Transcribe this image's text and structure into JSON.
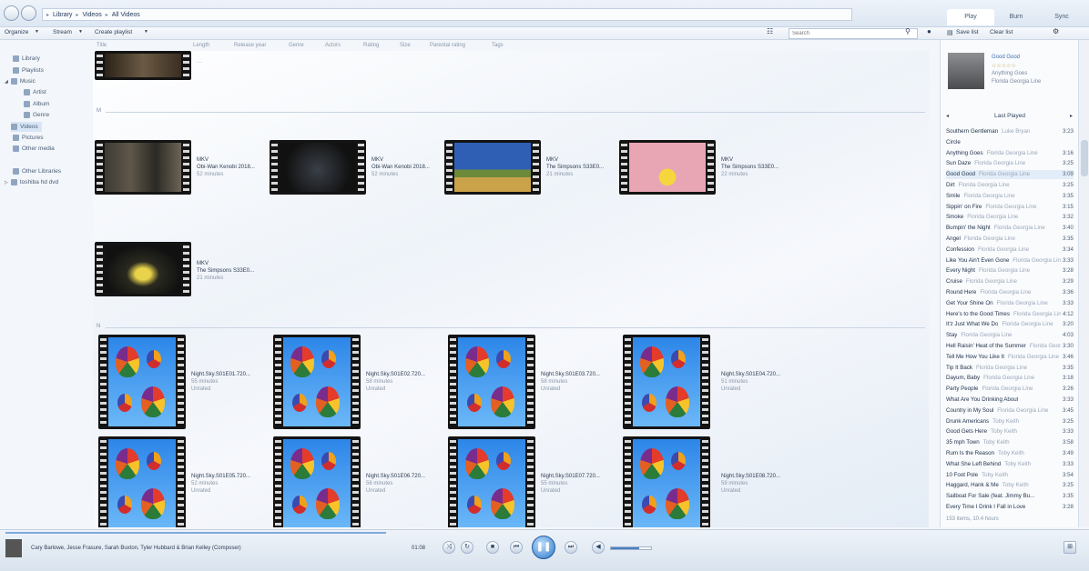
{
  "address": {
    "crumbs": [
      "Library",
      "Videos",
      "All Videos"
    ]
  },
  "pane_tabs": [
    "Play",
    "Burn",
    "Sync"
  ],
  "toolbar": {
    "organize": "Organize",
    "stream": "Stream",
    "create_playlist": "Create playlist",
    "search_placeholder": "Search",
    "save_list": "Save list",
    "clear_list": "Clear list"
  },
  "columns": [
    "Title",
    "Length",
    "Release year",
    "Genre",
    "Actors",
    "Rating",
    "Size",
    "Parental rating",
    "Tags"
  ],
  "nav": {
    "items": [
      {
        "label": "Library"
      },
      {
        "label": "Playlists"
      },
      {
        "label": "Music"
      },
      {
        "label": "Artist"
      },
      {
        "label": "Album"
      },
      {
        "label": "Genre"
      },
      {
        "label": "Videos"
      },
      {
        "label": "Pictures"
      },
      {
        "label": "Other media"
      },
      {
        "label": "Other Libraries"
      },
      {
        "label": "toshiba hd dvd"
      }
    ]
  },
  "groups": [
    {
      "label": "M"
    },
    {
      "label": "N"
    }
  ],
  "videos": [
    {
      "line1": "MKV",
      "line2": "Obi-Wan Kenobi 2018...",
      "line3": "52 minutes"
    },
    {
      "line1": "MKV",
      "line2": "Obi-Wan Kenobi 2018...",
      "line3": "52 minutes"
    },
    {
      "line1": "MKV",
      "line2": "The Simpsons S33E0...",
      "line3": "21 minutes"
    },
    {
      "line1": "MKV",
      "line2": "The Simpsons S33E0...",
      "line3": "22 minutes"
    },
    {
      "line1": "MKV",
      "line2": "The Simpsons S33E0...",
      "line3": "21 minutes"
    }
  ],
  "night_sky": [
    {
      "title": "Night.Sky.S01E01.720...",
      "length": "55 minutes",
      "genre": "Unrated"
    },
    {
      "title": "Night.Sky.S01E02.720...",
      "length": "58 minutes",
      "genre": "Unrated"
    },
    {
      "title": "Night.Sky.S01E03.720...",
      "length": "58 minutes",
      "genre": "Unrated"
    },
    {
      "title": "Night.Sky.S01E04.720...",
      "length": "51 minutes",
      "genre": "Unrated"
    },
    {
      "title": "Night.Sky.S01E05.720...",
      "length": "52 minutes",
      "genre": "Unrated"
    },
    {
      "title": "Night.Sky.S01E06.720...",
      "length": "56 minutes",
      "genre": "Unrated"
    },
    {
      "title": "Night.Sky.S01E07.720...",
      "length": "55 minutes",
      "genre": "Unrated"
    },
    {
      "title": "Night.Sky.S01E08.720...",
      "length": "59 minutes",
      "genre": "Unrated"
    }
  ],
  "now_playing": {
    "song": "Good Good",
    "stars": "☆☆☆☆☆",
    "album": "Anything Goes",
    "artist": "Florida Georgia Line"
  },
  "list_header": "Last Played",
  "playlist": [
    {
      "t": "Southern Gentleman",
      "a": "Luke Bryan",
      "d": "3:23"
    },
    {
      "t": "Circle",
      "a": "",
      "d": ""
    },
    {
      "t": "Anything Goes",
      "a": "Florida Georgia Line",
      "d": "3:16"
    },
    {
      "t": "Sun Daze",
      "a": "Florida Georgia Line",
      "d": "3:25"
    },
    {
      "t": "Good Good",
      "a": "Florida Georgia Line",
      "d": "3:09"
    },
    {
      "t": "Dirt",
      "a": "Florida Georgia Line",
      "d": "3:25"
    },
    {
      "t": "Smile",
      "a": "Florida Georgia Line",
      "d": "3:35"
    },
    {
      "t": "Sippin' on Fire",
      "a": "Florida Georgia Line",
      "d": "3:15"
    },
    {
      "t": "Smoke",
      "a": "Florida Georgia Line",
      "d": "3:32"
    },
    {
      "t": "Bumpin' the Night",
      "a": "Florida Georgia Line",
      "d": "3:40"
    },
    {
      "t": "Angel",
      "a": "Florida Georgia Line",
      "d": "3:35"
    },
    {
      "t": "Confession",
      "a": "Florida Georgia Line",
      "d": "3:34"
    },
    {
      "t": "Like You Ain't Even Gone",
      "a": "Florida Georgia Line",
      "d": "3:33"
    },
    {
      "t": "Every Night",
      "a": "Florida Georgia Line",
      "d": "3:28"
    },
    {
      "t": "Cruise",
      "a": "Florida Georgia Line",
      "d": "3:29"
    },
    {
      "t": "Round Here",
      "a": "Florida Georgia Line",
      "d": "3:36"
    },
    {
      "t": "Get Your Shine On",
      "a": "Florida Georgia Line",
      "d": "3:33"
    },
    {
      "t": "Here's to the Good Times",
      "a": "Florida Georgia Line",
      "d": "4:12"
    },
    {
      "t": "It'z Just What We Do",
      "a": "Florida Georgia Line",
      "d": "3:20"
    },
    {
      "t": "Stay",
      "a": "Florida Georgia Line",
      "d": "4:03"
    },
    {
      "t": "Hell Raisin' Heat of the Summer",
      "a": "Florida Georgia Line",
      "d": "3:30"
    },
    {
      "t": "Tell Me How You Like It",
      "a": "Florida Georgia Line",
      "d": "3:46"
    },
    {
      "t": "Tip It Back",
      "a": "Florida Georgia Line",
      "d": "3:35"
    },
    {
      "t": "Dayum, Baby",
      "a": "Florida Georgia Line",
      "d": "3:18"
    },
    {
      "t": "Party People",
      "a": "Florida Georgia Line",
      "d": "3:26"
    },
    {
      "t": "What Are You Drinking About",
      "a": "",
      "d": "3:33"
    },
    {
      "t": "Country in My Soul",
      "a": "Florida Georgia Line",
      "d": "3:45"
    },
    {
      "t": "Drunk Americans",
      "a": "Toby Keith",
      "d": "3:25"
    },
    {
      "t": "Good Gets Here",
      "a": "Toby Keith",
      "d": "3:33"
    },
    {
      "t": "35 mph Town",
      "a": "Toby Keith",
      "d": "3:58"
    },
    {
      "t": "Rum Is the Reason",
      "a": "Toby Keith",
      "d": "3:49"
    },
    {
      "t": "What She Left Behind",
      "a": "Toby Keith",
      "d": "3:33"
    },
    {
      "t": "10 Foot Pole",
      "a": "Toby Keith",
      "d": "3:54"
    },
    {
      "t": "Haggard, Hank & Me",
      "a": "Toby Keith",
      "d": "3:25"
    },
    {
      "t": "Sailboat For Sale (feat. Jimmy Bu...",
      "a": "",
      "d": "3:35"
    },
    {
      "t": "Every Time I Drink I Fall in Love",
      "a": "",
      "d": "3:28"
    }
  ],
  "list_footer": "153 items, 10.4 hours",
  "player": {
    "now": "Cary Barlowe, Jesse Frasure, Sarah Buxton, Tyler Hubbard & Brian Kelley (Composer)",
    "time": "01:08",
    "volume": 0.7
  },
  "colors": {
    "accent": "#2f77c8",
    "seek": "#7fa9dc"
  },
  "icons": {
    "search": "magnifier",
    "play": "play-triangle",
    "prev": "skip-back",
    "next": "skip-forward"
  }
}
